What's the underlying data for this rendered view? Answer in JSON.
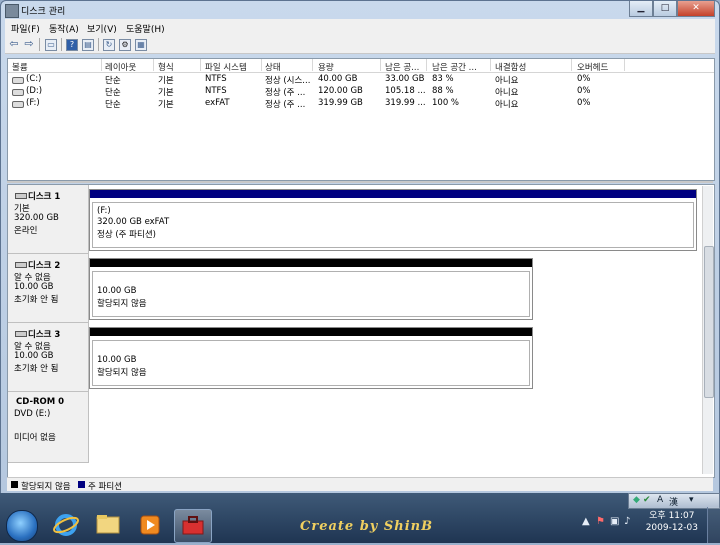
{
  "window": {
    "title": "디스크 관리",
    "minimize": "▁",
    "maximize": "□",
    "close": "✕"
  },
  "menu": [
    "파일(F)",
    "동작(A)",
    "보기(V)",
    "도움말(H)"
  ],
  "volume_columns": [
    "볼륨",
    "레이아웃",
    "형식",
    "파일 시스템",
    "상태",
    "용량",
    "남은 공...",
    "남은 공간 ...",
    "내결함성",
    "오버헤드"
  ],
  "volumes": [
    [
      "(C:)",
      "단순",
      "기본",
      "NTFS",
      "정상 (시스...",
      "40.00 GB",
      "33.00 GB",
      "83 %",
      "아니요",
      "0%"
    ],
    [
      "(D:)",
      "단순",
      "기본",
      "NTFS",
      "정상 (주 ...",
      "120.00 GB",
      "105.18 ...",
      "88 %",
      "아니요",
      "0%"
    ],
    [
      "(F:)",
      "단순",
      "기본",
      "exFAT",
      "정상 (주 ...",
      "319.99 GB",
      "319.99 ...",
      "100 %",
      "아니요",
      "0%"
    ]
  ],
  "disks": [
    {
      "name": "디스크 1",
      "lines": [
        "기본",
        "320.00 GB",
        "온라인"
      ],
      "part": [
        "(F:)",
        "320.00 GB exFAT",
        "정상 (주 파티션)"
      ]
    },
    {
      "name": "디스크 2",
      "lines": [
        "알 수 없음",
        "10.00 GB",
        "초기화 안 됨"
      ],
      "part": [
        "10.00 GB",
        "할당되지 않음"
      ]
    },
    {
      "name": "디스크 3",
      "lines": [
        "알 수 없음",
        "10.00 GB",
        "초기화 안 됨"
      ],
      "part": [
        "10.00 GB",
        "할당되지 않음"
      ]
    },
    {
      "name": "CD-ROM 0",
      "lines": [
        "DVD (E:)",
        "",
        "미디어 없음"
      ]
    }
  ],
  "legend": [
    "할당되지 않음",
    "주 파티션"
  ],
  "colors": {
    "primary": "#000080",
    "unallocated": "#000000"
  },
  "langbar": {
    "lang": "A",
    "ime": "漢"
  },
  "taskbar": {
    "brand": "Create by ShinB"
  },
  "clock": {
    "time": "오후 11:07",
    "date": "2009-12-03"
  }
}
